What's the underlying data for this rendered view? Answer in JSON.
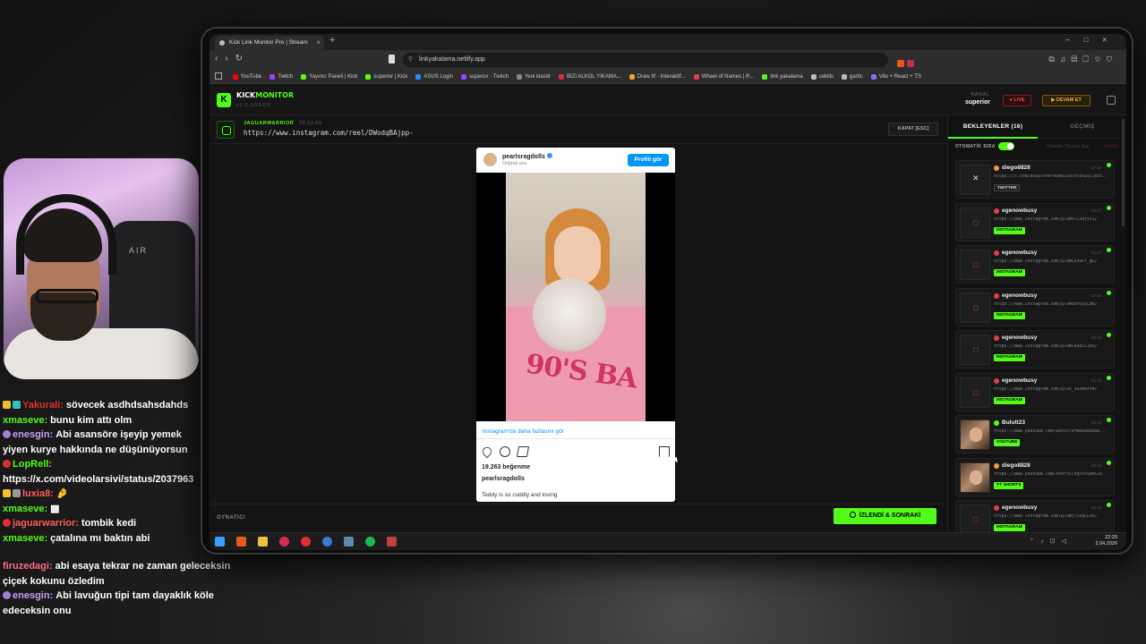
{
  "browser": {
    "tab_title": "Kick Link Monitor Pro | Stream",
    "url": "linkyakalama.netlify.app",
    "bookmarks": [
      {
        "label": "YouTube",
        "color": "#ff0000"
      },
      {
        "label": "Twitch",
        "color": "#9146ff"
      },
      {
        "label": "Yayıncı Paneli | Kick",
        "color": "#53fc18"
      },
      {
        "label": "superior | Kick",
        "color": "#53fc18"
      },
      {
        "label": "ASUS Login",
        "color": "#1e90ff"
      },
      {
        "label": "superior - Twitch",
        "color": "#9146ff"
      },
      {
        "label": "Yeni klasör",
        "color": "#888888"
      },
      {
        "label": "BIZI ALKOL YIKAMA...",
        "color": "#e03030"
      },
      {
        "label": "Draw It! - Interaktif...",
        "color": "#f0a030"
      },
      {
        "label": "Wheel of Names | R...",
        "color": "#e04040"
      },
      {
        "label": "link yakalama",
        "color": "#53fc18"
      },
      {
        "label": "cekilis",
        "color": "#bbbbbb"
      },
      {
        "label": "gartic",
        "color": "#bbbbbb"
      },
      {
        "label": "Vite + React + TS",
        "color": "#8a6af0"
      }
    ]
  },
  "app": {
    "brand_kick": "KICK",
    "brand_monitor": "MONITOR",
    "logo_letter": "K",
    "version": "v1.0 GREEN",
    "kanal_label": "KANAL",
    "kanal_value": "superior",
    "live_label": "● LIVE",
    "devam_label": "▶ DEVAM ET",
    "accent": "#53fc18"
  },
  "current": {
    "sender": "JAGUARWARRIOR",
    "time": "22:12:55",
    "url": "https://www.instagram.com/reel/DWodqBAjpp-",
    "close_label": "KAPAT [ESC]"
  },
  "embed": {
    "username": "pearlsragdolls",
    "subtitle": "Orijinal ses",
    "profile_button": "Profili gör",
    "more_link": "Instagram'da daha fazlasını gör",
    "likes": "19.263 beğenme",
    "account": "pearlsragdolls",
    "caption": "Teddy is so cuddly and loving",
    "shirt_text": "90'S BA"
  },
  "footer": {
    "player_label": "OYNATICI",
    "next_button": "İZLENDİ & SONRAKİ"
  },
  "sidebar": {
    "tab_waiting": "BEKLEYENLER (16)",
    "tab_history": "GEÇMİŞ",
    "auto_label": "OTOMATİK SIRA",
    "read_all": "Tümünü Okundu Say",
    "clear_all": "Temizle",
    "queue": [
      {
        "user": "diego8828",
        "time": "22:18",
        "url": "https://x.com/asayisherkomali0/status/2035...",
        "badge": "TWITTER",
        "kind": "tw",
        "dot": "#f0a030"
      },
      {
        "user": "egenowbusy",
        "time": "22:17",
        "url": "https://www.instagram.com/p/DWxlCS0jVt1/",
        "badge": "INSTAGRAM",
        "kind": "ig",
        "dot": "#e04040"
      },
      {
        "user": "egenowbusy",
        "time": "22:17",
        "url": "https://www.instagram.com/p/DWLzX9Pt_gL/",
        "badge": "INSTAGRAM",
        "kind": "ig",
        "dot": "#e04040"
      },
      {
        "user": "egenowbusy",
        "time": "22:16",
        "url": "https://www.instagram.com/p/DWoxFOyiCmo/",
        "badge": "INSTAGRAM",
        "kind": "ig",
        "dot": "#e04040"
      },
      {
        "user": "egenowbusy",
        "time": "22:16",
        "url": "https://www.instagram.com/p/DWloaat13zs/",
        "badge": "INSTAGRAM",
        "kind": "ig",
        "dot": "#e04040"
      },
      {
        "user": "egenowbusy",
        "time": "22:16",
        "url": "https://www.instagram.com/p/DU_1A3BArV4/",
        "badge": "INSTAGRAM",
        "kind": "ig",
        "dot": "#e04040"
      },
      {
        "user": "Bulutt23",
        "time": "22:15",
        "url": "https://www.youtube.com/watch?v=BBuA8Dda8...",
        "badge": "YOUTUBE",
        "kind": "yt",
        "dot": "#53fc18"
      },
      {
        "user": "diego8828",
        "time": "22:15",
        "url": "https://www.youtube.com/shorts/zqYxv58HlXs",
        "badge": "YT SHORTS",
        "kind": "yt",
        "dot": "#f0a030"
      },
      {
        "user": "egenowbusy",
        "time": "22:15",
        "url": "https://www.instagram.com/p/DWjTszgCLUv/",
        "badge": "INSTAGRAM",
        "kind": "ig",
        "dot": "#e04040"
      }
    ]
  },
  "taskbar": {
    "time": "22:20",
    "date": "2.04.2026"
  },
  "webcam": {
    "chair_text": "AIR"
  },
  "chat": [
    {
      "user": "Yakurali:",
      "color": "#e03030",
      "msg": "sövecek asdhdsahsdahds"
    },
    {
      "user": "xmaseve:",
      "color": "#53fc18",
      "msg": "bunu kim attı olm"
    },
    {
      "user": "enesgin:",
      "color": "#c8a0f0",
      "msg": "Abi asansöre işeyip yemek yiyen kurye hakkında ne düşünüyorsun"
    },
    {
      "user": "LopRell:",
      "color": "#53fc18",
      "msg": "https://x.com/videolarsivi/status/2037963"
    },
    {
      "user": "luxia8:",
      "color": "#ff5a5a",
      "msg": "🤌"
    },
    {
      "user": "xmaseve:",
      "color": "#53fc18",
      "msg": "▩"
    },
    {
      "user": "jaguarwarrior:",
      "color": "#ff5a5a",
      "msg": "tombik kedi"
    },
    {
      "user": "xmaseve:",
      "color": "#53fc18",
      "msg": "çatalına mı baktın abi"
    },
    {
      "user": "firuzedagi:",
      "color": "#ff6a8a",
      "msg": "abi esaya tekrar ne zaman geleceksin çiçek kokunu özledim"
    },
    {
      "user": "enesgin:",
      "color": "#c8a0f0",
      "msg": "Abi lavuğun tipi tam dayaklık köle edeceksin onu"
    }
  ]
}
